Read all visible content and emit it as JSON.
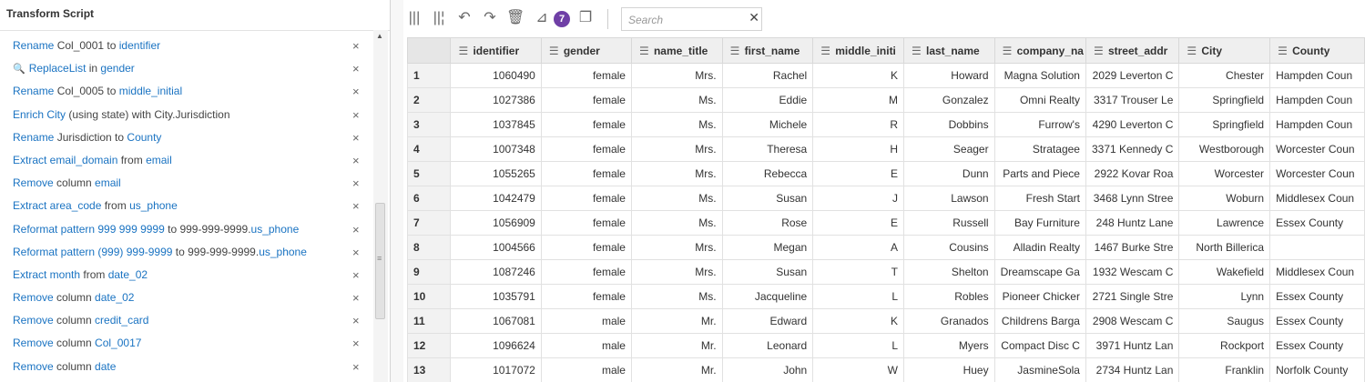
{
  "left_panel": {
    "title": "Transform Script",
    "steps": [
      {
        "parts": [
          [
            "kw",
            "Rename"
          ],
          [
            "tx",
            " Col_0001 to "
          ],
          [
            "kw",
            "identifier"
          ]
        ]
      },
      {
        "icon": "search-icon",
        "parts": [
          [
            "kw",
            "ReplaceList"
          ],
          [
            "tx",
            " in "
          ],
          [
            "kw",
            "gender"
          ]
        ]
      },
      {
        "parts": [
          [
            "kw",
            "Rename"
          ],
          [
            "tx",
            " Col_0005 to "
          ],
          [
            "kw",
            "middle_initial"
          ]
        ]
      },
      {
        "parts": [
          [
            "kw",
            "Enrich City"
          ],
          [
            "tx",
            " (using state) with City.Jurisdiction"
          ]
        ]
      },
      {
        "parts": [
          [
            "kw",
            "Rename"
          ],
          [
            "tx",
            " Jurisdiction to "
          ],
          [
            "kw",
            "County"
          ]
        ]
      },
      {
        "parts": [
          [
            "kw",
            "Extract email_domain"
          ],
          [
            "tx",
            " from "
          ],
          [
            "kw",
            "email"
          ]
        ]
      },
      {
        "parts": [
          [
            "kw",
            "Remove"
          ],
          [
            "tx",
            " column "
          ],
          [
            "kw",
            "email"
          ]
        ]
      },
      {
        "parts": [
          [
            "kw",
            "Extract area_code"
          ],
          [
            "tx",
            " from "
          ],
          [
            "kw",
            "us_phone"
          ]
        ]
      },
      {
        "parts": [
          [
            "kw",
            "Reformat pattern 999 999 9999"
          ],
          [
            "tx",
            " to 999-999-9999."
          ],
          [
            "kw",
            "us_phone"
          ]
        ]
      },
      {
        "parts": [
          [
            "kw",
            "Reformat pattern (999) 999-9999"
          ],
          [
            "tx",
            " to 999-999-9999."
          ],
          [
            "kw",
            "us_phone"
          ]
        ]
      },
      {
        "parts": [
          [
            "kw",
            "Extract month"
          ],
          [
            "tx",
            " from "
          ],
          [
            "kw",
            "date_02"
          ]
        ]
      },
      {
        "parts": [
          [
            "kw",
            "Remove"
          ],
          [
            "tx",
            " column "
          ],
          [
            "kw",
            "date_02"
          ]
        ]
      },
      {
        "parts": [
          [
            "kw",
            "Remove"
          ],
          [
            "tx",
            " column "
          ],
          [
            "kw",
            "credit_card"
          ]
        ]
      },
      {
        "parts": [
          [
            "kw",
            "Remove"
          ],
          [
            "tx",
            " column "
          ],
          [
            "kw",
            "Col_0017"
          ]
        ]
      },
      {
        "parts": [
          [
            "kw",
            "Remove"
          ],
          [
            "tx",
            " column "
          ],
          [
            "kw",
            "date"
          ]
        ]
      }
    ],
    "remove_glyph": "×"
  },
  "toolbar": {
    "icons": [
      "columns-icon",
      "columns-add-icon",
      "undo-icon",
      "redo-icon",
      "delete-icon",
      "transform-icon",
      "copy-icon"
    ],
    "badge": "7",
    "search_placeholder": "Search",
    "search_value": ""
  },
  "grid": {
    "columns": [
      "identifier",
      "gender",
      "name_title",
      "first_name",
      "middle_initi",
      "last_name",
      "company_na",
      "street_addr",
      "City",
      "County"
    ],
    "rows": [
      [
        "1",
        "1060490",
        "female",
        "Mrs.",
        "Rachel",
        "K",
        "Howard",
        "Magna Solution",
        "2029 Leverton C",
        "Chester",
        "Hampden Coun"
      ],
      [
        "2",
        "1027386",
        "female",
        "Ms.",
        "Eddie",
        "M",
        "Gonzalez",
        "Omni Realty",
        "3317 Trouser Le",
        "Springfield",
        "Hampden Coun"
      ],
      [
        "3",
        "1037845",
        "female",
        "Ms.",
        "Michele",
        "R",
        "Dobbins",
        "Furrow's",
        "4290 Leverton C",
        "Springfield",
        "Hampden Coun"
      ],
      [
        "4",
        "1007348",
        "female",
        "Mrs.",
        "Theresa",
        "H",
        "Seager",
        "Stratagee",
        "3371 Kennedy C",
        "Westborough",
        "Worcester Coun"
      ],
      [
        "5",
        "1055265",
        "female",
        "Mrs.",
        "Rebecca",
        "E",
        "Dunn",
        "Parts and Piece",
        "2922 Kovar Roa",
        "Worcester",
        "Worcester Coun"
      ],
      [
        "6",
        "1042479",
        "female",
        "Ms.",
        "Susan",
        "J",
        "Lawson",
        "Fresh Start",
        "3468 Lynn Stree",
        "Woburn",
        "Middlesex Coun"
      ],
      [
        "7",
        "1056909",
        "female",
        "Ms.",
        "Rose",
        "E",
        "Russell",
        "Bay Furniture",
        "248 Huntz Lane",
        "Lawrence",
        "Essex County"
      ],
      [
        "8",
        "1004566",
        "female",
        "Mrs.",
        "Megan",
        "A",
        "Cousins",
        "Alladin Realty",
        "1467 Burke Stre",
        "North Billerica",
        ""
      ],
      [
        "9",
        "1087246",
        "female",
        "Mrs.",
        "Susan",
        "T",
        "Shelton",
        "Dreamscape Ga",
        "1932 Wescam C",
        "Wakefield",
        "Middlesex Coun"
      ],
      [
        "10",
        "1035791",
        "female",
        "Ms.",
        "Jacqueline",
        "L",
        "Robles",
        "Pioneer Chicker",
        "2721 Single Stre",
        "Lynn",
        "Essex County"
      ],
      [
        "11",
        "1067081",
        "male",
        "Mr.",
        "Edward",
        "K",
        "Granados",
        "Childrens Barga",
        "2908 Wescam C",
        "Saugus",
        "Essex County"
      ],
      [
        "12",
        "1096624",
        "male",
        "Mr.",
        "Leonard",
        "L",
        "Myers",
        "Compact Disc C",
        "3971 Huntz Lan",
        "Rockport",
        "Essex County"
      ],
      [
        "13",
        "1017072",
        "male",
        "Mr.",
        "John",
        "W",
        "Huey",
        "JasmineSola",
        "2734 Huntz Lan",
        "Franklin",
        "Norfolk County"
      ]
    ]
  }
}
